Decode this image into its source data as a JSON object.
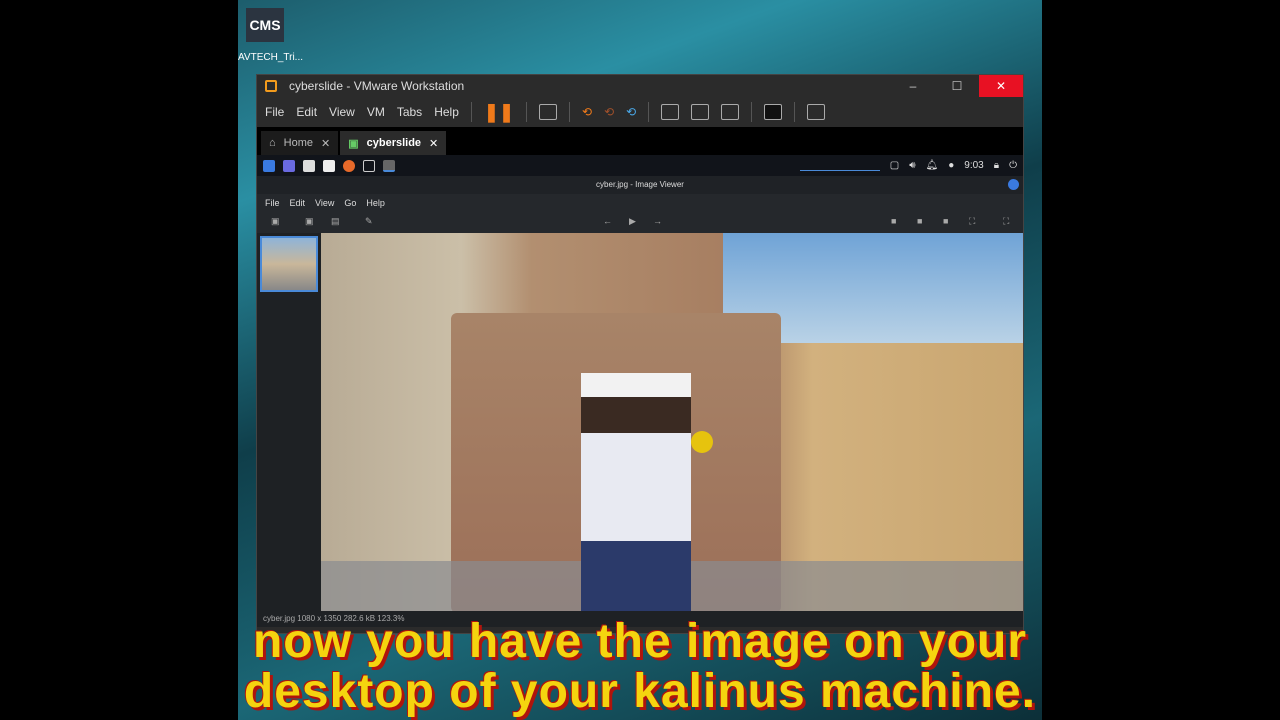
{
  "desktop": {
    "icon_text": "CMS",
    "icon_label": "AVTECH_Tri..."
  },
  "window": {
    "title": "cyberslide - VMware Workstation",
    "min": "–",
    "max": "☐",
    "close": "✕"
  },
  "menu": [
    "File",
    "Edit",
    "View",
    "VM",
    "Tabs",
    "Help"
  ],
  "tabs": [
    {
      "label": "Home",
      "close": "✕"
    },
    {
      "label": "cyberslide",
      "close": "✕"
    }
  ],
  "panel": {
    "clock": "9:03"
  },
  "viewer": {
    "title": "cyber.jpg - Image Viewer",
    "menu": [
      "File",
      "Edit",
      "View",
      "Go",
      "Help"
    ],
    "status": "cyber.jpg   1080 x 1350   282.6 kB   123.3%"
  },
  "subtitle": {
    "line1": "now you have the image on your",
    "line2": "desktop of your kalinus machine."
  }
}
